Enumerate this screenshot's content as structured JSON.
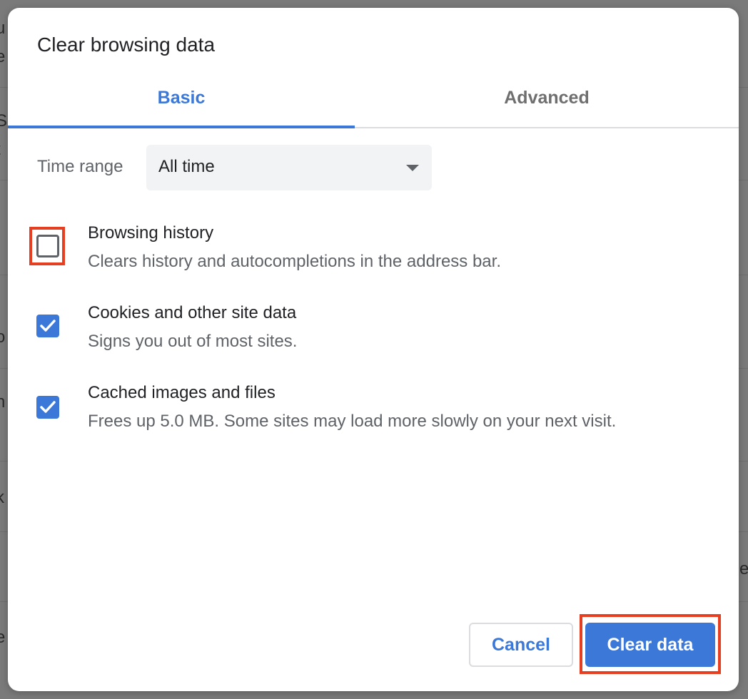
{
  "dialog": {
    "title": "Clear browsing data"
  },
  "tabs": [
    {
      "label": "Basic",
      "active": true
    },
    {
      "label": "Advanced",
      "active": false
    }
  ],
  "time_range": {
    "label": "Time range",
    "selected": "All time"
  },
  "options": [
    {
      "title": "Browsing history",
      "description": "Clears history and autocompletions in the address bar.",
      "checked": false
    },
    {
      "title": "Cookies and other site data",
      "description": "Signs you out of most sites.",
      "checked": true
    },
    {
      "title": "Cached images and files",
      "description": "Frees up 5.0 MB. Some sites may load more slowly on your next visit.",
      "checked": true
    }
  ],
  "buttons": {
    "cancel": "Cancel",
    "clear": "Clear data"
  },
  "colors": {
    "accent": "#3c78d8",
    "highlight": "#e53e20"
  }
}
